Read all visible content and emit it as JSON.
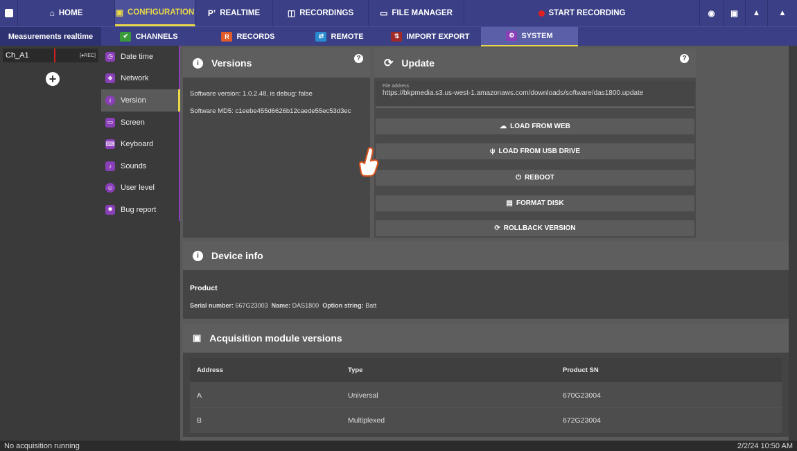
{
  "topnav": {
    "menu_icon": "menu-square-icon",
    "items": [
      {
        "label": "HOME",
        "icon": "home-icon"
      },
      {
        "label": "CONFIGURATION",
        "icon": "config-icon"
      },
      {
        "label": "REALTIME",
        "icon": "realtime-icon"
      },
      {
        "label": "RECORDINGS",
        "icon": "recordings-icon"
      },
      {
        "label": "FILE MANAGER",
        "icon": "folder-icon"
      }
    ],
    "start_recording": "START RECORDING"
  },
  "subnav": {
    "left_title": "Measurements realtime",
    "items": [
      "CHANNELS",
      "RECORDS",
      "REMOTE",
      "IMPORT EXPORT",
      "SYSTEM"
    ]
  },
  "channels": [
    {
      "name": "Ch_A1",
      "tag": "[●REC]"
    }
  ],
  "menu": [
    "Date time",
    "Network",
    "Version",
    "Screen",
    "Keyboard",
    "Sounds",
    "User level",
    "Bug report"
  ],
  "versions": {
    "title": "Versions",
    "software_version": "Software version: 1.0.2.48, is debug: false",
    "software_md5": "Software MD5: c1eebe455d6626b12caede55ec53d3ec"
  },
  "update": {
    "title": "Update",
    "file_label": "File address",
    "file_value": "https://bkpmedia.s3.us-west-1.amazonaws.com/downloads/software/das1800.update",
    "buttons": [
      "LOAD FROM WEB",
      "LOAD FROM USB DRIVE",
      "REBOOT",
      "FORMAT DISK",
      "ROLLBACK VERSION"
    ]
  },
  "device": {
    "title": "Device info",
    "product": "Product",
    "serial_label": "Serial number:",
    "serial": "667G23003",
    "name_label": "Name:",
    "name": "DAS1800",
    "option_label": "Option string:",
    "option": "Batt"
  },
  "acq": {
    "title": "Acquisition module versions",
    "headers": [
      "Address",
      "Type",
      "Product SN"
    ],
    "rows": [
      [
        "A",
        "Universal",
        "670G23004"
      ],
      [
        "B",
        "Multiplexed",
        "672G23004"
      ]
    ]
  },
  "status": {
    "left": "No acquisition running",
    "right": "2/2/24 10:50 AM"
  },
  "colors": {
    "nav": "#3b3f86",
    "accent": "#e8d84a",
    "record": "#e02020",
    "menu_accent": "#8a3fb8"
  }
}
